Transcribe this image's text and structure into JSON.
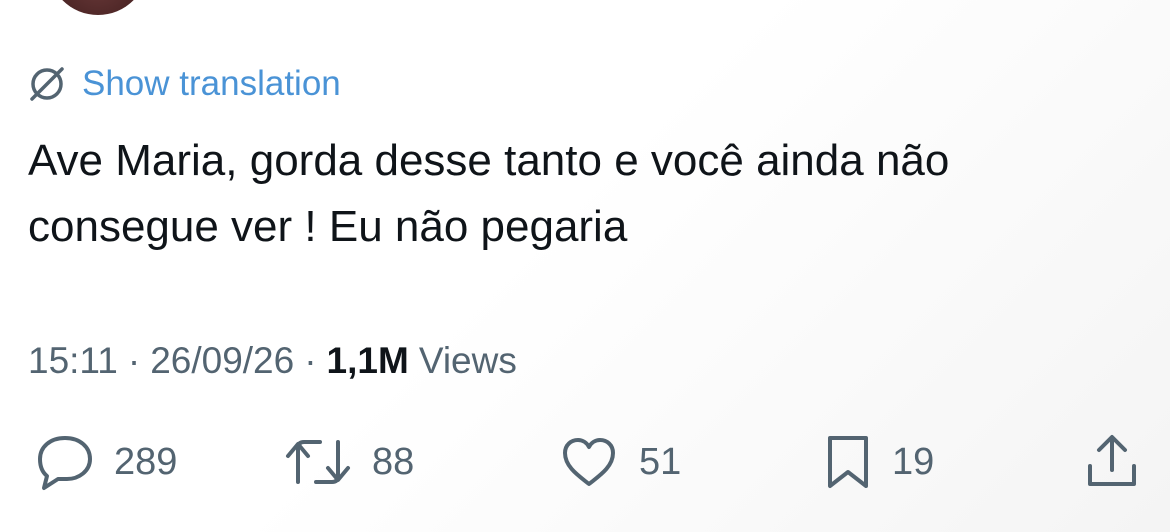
{
  "tweet": {
    "translate_label": "Show translation",
    "text_line1": "Ave Maria, gorda desse tanto e você ainda não",
    "text_line2": "consegue ver ! Eu não pegaria"
  },
  "meta": {
    "time": "15:11",
    "separator": "·",
    "date": "26/09/26",
    "views_count": "1,1M",
    "views_label": "Views"
  },
  "actions": {
    "replies": "289",
    "reposts": "88",
    "likes": "51",
    "bookmarks": "19"
  },
  "colors": {
    "link": "#4a93d6",
    "text": "#0f1419",
    "muted": "#536471"
  },
  "icons": [
    "translate-icon",
    "reply-icon",
    "repost-icon",
    "like-icon",
    "bookmark-icon",
    "share-icon"
  ]
}
